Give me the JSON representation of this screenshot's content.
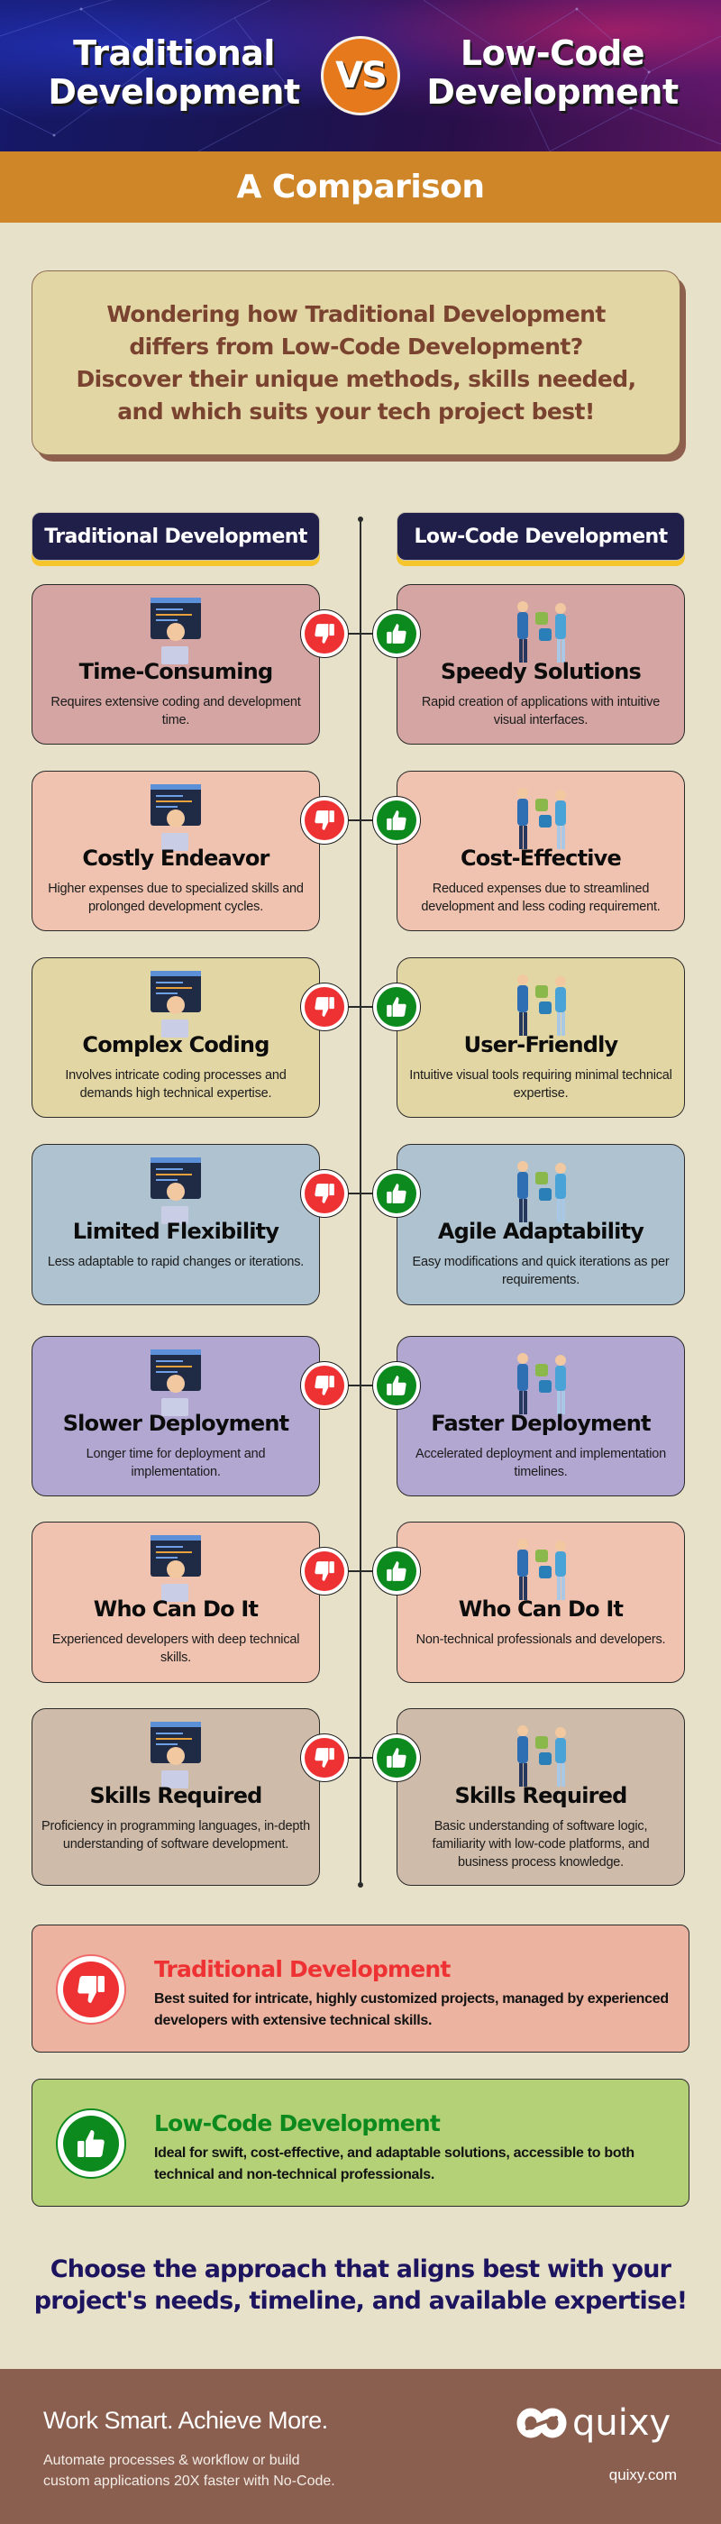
{
  "hero": {
    "left_title_line1": "Traditional",
    "left_title_line2": "Development",
    "vs": "VS",
    "right_title_line1": "Low-Code",
    "right_title_line2": "Development"
  },
  "banner": {
    "title": "A Comparison"
  },
  "intro": {
    "text": "Wondering how Traditional Development differs from Low-Code Development? Discover their unique methods, skills needed, and which suits your tech project best!"
  },
  "columns": {
    "left_header": "Traditional Development",
    "right_header": "Low-Code Development"
  },
  "rows": [
    {
      "color": "#d4a5a2",
      "left": {
        "illustration": "developer-at-screen-illustration",
        "title": "Time-Consuming",
        "desc": "Requires extensive coding and development time."
      },
      "right": {
        "illustration": "team-puzzle-illustration",
        "title": "Speedy Solutions",
        "desc": "Rapid creation of applications with intuitive visual interfaces."
      }
    },
    {
      "color": "#f0c3b0",
      "left": {
        "illustration": "expensive-app-illustration",
        "title": "Costly Endeavor",
        "desc": "Higher expenses due to specialized skills and prolonged development cycles."
      },
      "right": {
        "illustration": "savings-chart-illustration",
        "title": "Cost-Effective",
        "desc": "Reduced expenses due to streamlined development and less coding requirement."
      }
    },
    {
      "color": "#e3d6a5",
      "left": {
        "illustration": "coding-team-illustration",
        "title": "Complex Coding",
        "desc": "Involves intricate coding processes and demands high technical expertise."
      },
      "right": {
        "illustration": "visual-builder-illustration",
        "title": "User-Friendly",
        "desc": "Intuitive visual tools requiring minimal technical expertise."
      }
    },
    {
      "color": "#aec2cf",
      "left": {
        "illustration": "code-window-illustration",
        "title": "Limited Flexibility",
        "desc": "Less adaptable to rapid changes or iterations."
      },
      "right": {
        "illustration": "agile-cycle-illustration",
        "title": "Agile Adaptability",
        "desc": "Easy modifications and quick iterations as per requirements."
      }
    },
    {
      "color": "#b1a7d1",
      "left": {
        "illustration": "monitor-dashboard-illustration",
        "title": "Slower Deployment",
        "desc": "Longer time for deployment and implementation."
      },
      "right": {
        "illustration": "cloud-upload-illustration",
        "title": "Faster Deployment",
        "desc": "Accelerated deployment and implementation timelines."
      }
    },
    {
      "color": "#f0c3b0",
      "left": {
        "illustration": "developer-desk-illustration",
        "title": "Who Can Do It",
        "desc": "Experienced developers with deep technical skills."
      },
      "right": {
        "illustration": "collaboration-illustration",
        "title": "Who Can Do It",
        "desc": "Non-technical professionals and developers."
      }
    },
    {
      "color": "#cfbba9",
      "left": {
        "illustration": "programmer-illustration",
        "title": "Skills Required",
        "desc": "Proficiency in programming languages, in-depth understanding of software development."
      },
      "right": {
        "illustration": "analytics-team-illustration",
        "title": "Skills Required",
        "desc": "Basic understanding of software logic, familiarity with low-code platforms, and business process knowledge."
      }
    }
  ],
  "icons": {
    "con": "thumbs-down-icon",
    "pro": "thumbs-up-icon"
  },
  "colors": {
    "con": "#ee3233",
    "pro": "#0c8a1d",
    "banner": "#cf8629",
    "header": "#201f4a",
    "accent": "#f6c52c"
  },
  "summary": {
    "traditional": {
      "title": "Traditional Development",
      "desc": "Best suited for intricate, highly customized projects, managed by experienced developers with extensive technical skills."
    },
    "lowcode": {
      "title": "Low-Code Development",
      "desc": "Ideal for swift, cost-effective, and adaptable solutions, accessible to both technical and non-technical professionals."
    }
  },
  "closing": {
    "text": "Choose the approach that aligns best with your project's needs, timeline, and available expertise!"
  },
  "footer": {
    "tagline": "Work Smart. Achieve More.",
    "sub_line1": "Automate processes & workflow or build",
    "sub_line2": "custom applications 20X faster with No-Code.",
    "logo_text": "quixy",
    "url": "quixy.com"
  }
}
